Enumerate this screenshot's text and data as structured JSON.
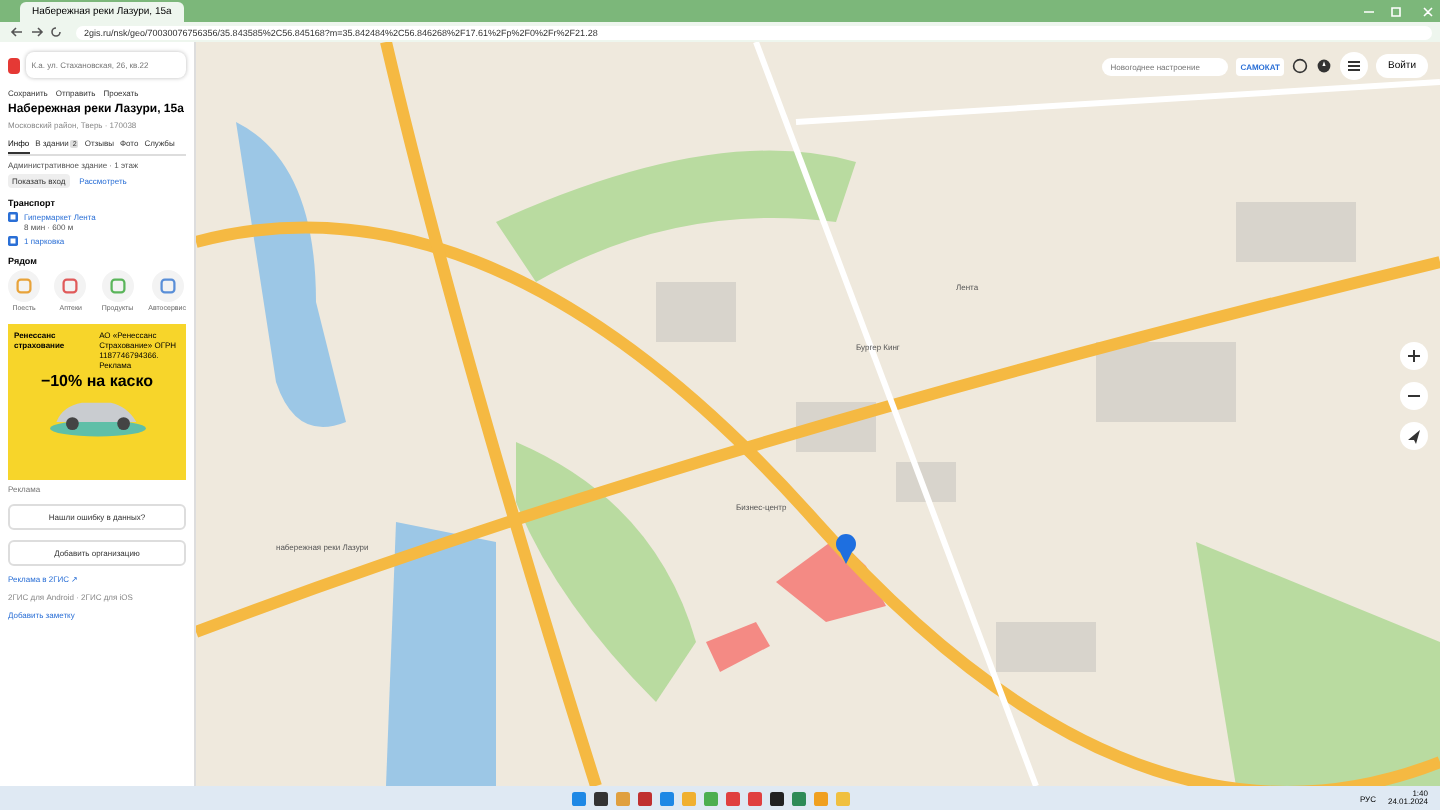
{
  "browser": {
    "tab_title": "Набережная реки Лазури, 15а",
    "url": "2gis.ru/nsk/geo/70030076756356/35.843585%2C56.845168?m=35.842484%2C56.846268%2F17.61%2Fp%2F0%2Fr%2F21.28"
  },
  "panel": {
    "search": {
      "placeholder": "К.а. ул. Стахановская, 26, кв.22"
    },
    "actions": [
      "Сохранить",
      "Отправить",
      "Проехать"
    ],
    "title": "Набережная реки Лазури, 15а",
    "subtitle": "Московский район, Тверь · 170038",
    "tabs": [
      {
        "label": "Инфо",
        "selected": true
      },
      {
        "label": "В здании",
        "selected": false,
        "badge": "2"
      },
      {
        "label": "Отзывы",
        "selected": false
      },
      {
        "label": "Фото",
        "selected": false
      },
      {
        "label": "Службы",
        "selected": false
      }
    ],
    "building": "Административное здание · 1 этаж",
    "building_buttons": [
      "Показать вход",
      "Рассмотреть"
    ],
    "transport": {
      "heading": "Транспорт",
      "items": [
        {
          "name": "Гипермаркет Лента",
          "detail": "8 мин · 600 м"
        },
        {
          "name": "1 парковка"
        }
      ]
    },
    "nearby": {
      "heading": "Рядом",
      "items": [
        "Поесть",
        "Аптеки",
        "Продукты",
        "Автосервис"
      ]
    },
    "ad": {
      "brand": "Ренессанс страхование",
      "note": "АО «Ренессанс Страхование» ОГРН 1187746794366. Реклама",
      "headline": "−10% на каско",
      "caption": "Реклама"
    },
    "buttons": [
      "Нашли ошибку в данных?",
      "Добавить организацию"
    ],
    "links": [
      "Реклама в 2ГИС ↗",
      "2ГИС для Android · 2ГИС для iOS",
      "Добавить заметку"
    ]
  },
  "map": {
    "search": {
      "placeholder": "Новогоднее настроение"
    },
    "badge": "САМОКАТ",
    "login": "Войти",
    "labels": [
      "Бургер Кинг",
      "Лента",
      "набережная реки Лазури",
      "Бизнес-центр"
    ]
  },
  "taskbar": {
    "lang": "РУС",
    "time": "1:40",
    "date": "24.01.2024"
  }
}
